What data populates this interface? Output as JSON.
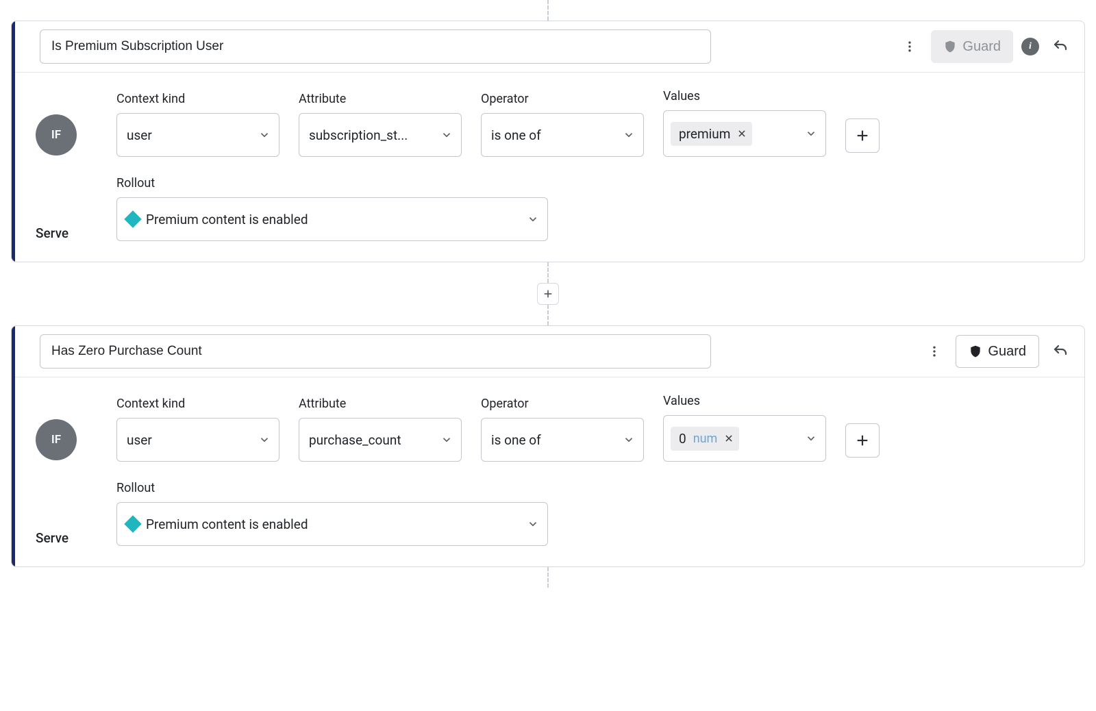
{
  "labels": {
    "context_kind": "Context kind",
    "attribute": "Attribute",
    "operator": "Operator",
    "values": "Values",
    "rollout": "Rollout",
    "serve": "Serve",
    "if": "IF",
    "guard": "Guard"
  },
  "rules": [
    {
      "name": "Is Premium Subscription User",
      "guard_enabled": false,
      "show_info_badge": true,
      "condition": {
        "context_kind": "user",
        "attribute": "subscription_st...",
        "operator": "is one of",
        "values": [
          {
            "text": "premium",
            "type": ""
          }
        ]
      },
      "serve": {
        "variation": "Premium content is enabled",
        "color": "#1fb6bf"
      }
    },
    {
      "name": "Has Zero Purchase Count",
      "guard_enabled": true,
      "show_info_badge": false,
      "condition": {
        "context_kind": "user",
        "attribute": "purchase_count",
        "operator": "is one of",
        "values": [
          {
            "text": "0",
            "type": "num"
          }
        ]
      },
      "serve": {
        "variation": "Premium content is enabled",
        "color": "#1fb6bf"
      }
    }
  ]
}
